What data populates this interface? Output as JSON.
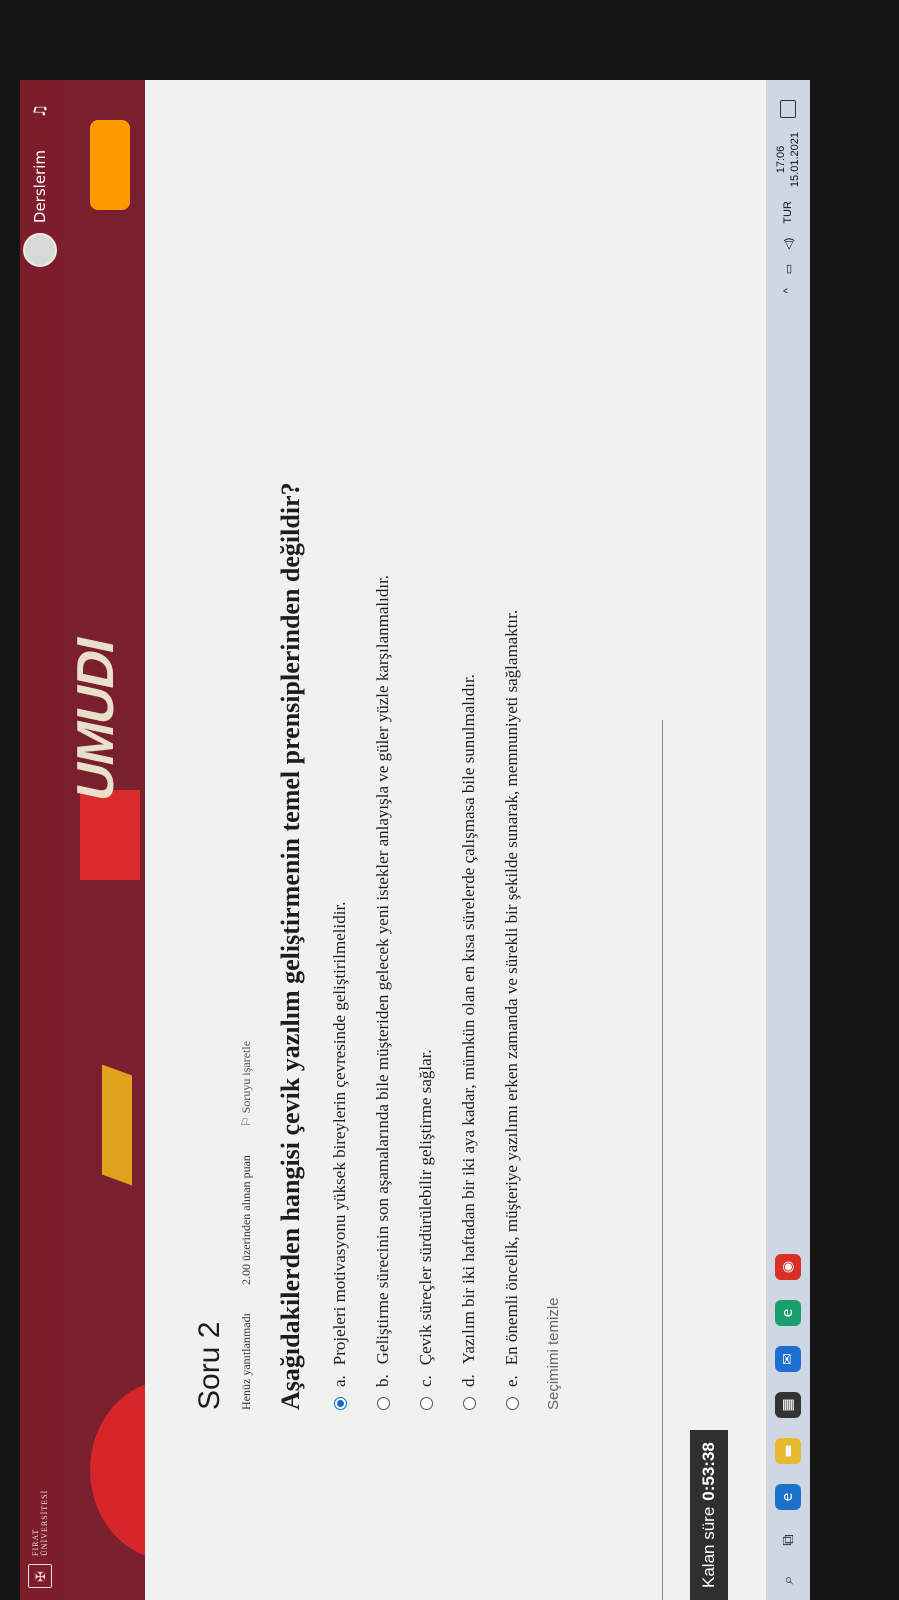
{
  "header": {
    "logo_line1": "FIRAT",
    "logo_line2": "ÜNİVERSİTESİ",
    "courses_label": "Derslerim",
    "bell_icon": "bell-icon"
  },
  "banner": {
    "word": "UMUDI"
  },
  "question": {
    "title": "Soru 2",
    "status": "Henüz yanıtlanmadı",
    "points": "2.00 üzerinden alınan puan",
    "flag_label": "Soruyu işaretle",
    "prompt": "Aşağıdakilerden hangisi çevik yazılım geliştirmenin temel prensiplerinden değildir?",
    "options": [
      {
        "letter": "a.",
        "text": "Projeleri motivasyonu yüksek bireylerin çevresinde geliştirilmelidir.",
        "selected": true
      },
      {
        "letter": "b.",
        "text": "Geliştirme sürecinin son aşamalarında bile müşteriden gelecek yeni istekler anlayışla ve güler yüzle karşılanmalıdır.",
        "selected": false
      },
      {
        "letter": "c.",
        "text": "Çevik süreçler sürdürülebilir geliştirme sağlar.",
        "selected": false
      },
      {
        "letter": "d.",
        "text": "Yazılım bir iki haftadan bir iki aya kadar, mümkün olan en kısa sürelerde çalışmasa bile sunulmalıdır.",
        "selected": false
      },
      {
        "letter": "e.",
        "text": "En önemli öncelik, müşteriye yazılımı erken zamanda ve sürekli bir şekilde sunarak, memnuniyeti sağlamaktır.",
        "selected": false
      }
    ],
    "clear_label": "Seçimimi temizle"
  },
  "timer": {
    "label": "Kalan süre",
    "value": "0:53:38"
  },
  "taskbar": {
    "apps": [
      {
        "icon": "edge-icon",
        "color": "#1a73c8",
        "glyph": "e"
      },
      {
        "icon": "file-explorer-icon",
        "color": "#e8b931",
        "glyph": "▬"
      },
      {
        "icon": "store-icon",
        "color": "#333333",
        "glyph": "▦"
      },
      {
        "icon": "mail-icon",
        "color": "#1e6fd0",
        "glyph": "✉"
      },
      {
        "icon": "edge-new-icon",
        "color": "#1b9e6b",
        "glyph": "e"
      },
      {
        "icon": "chrome-icon",
        "color": "#d93025",
        "glyph": "◉"
      }
    ],
    "language": "TUR",
    "time": "17:06",
    "date": "15.01.2021"
  }
}
